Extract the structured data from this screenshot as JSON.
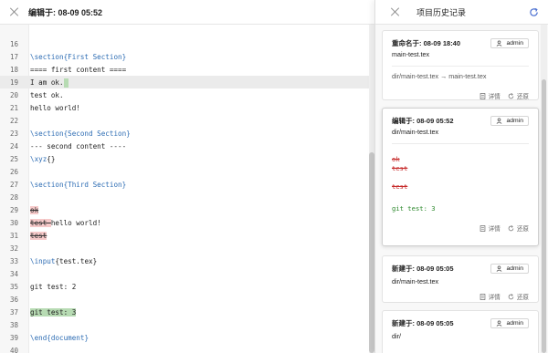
{
  "editor": {
    "title": "编辑于: 08-09 05:52",
    "lines": [
      {
        "num": "16",
        "segments": []
      },
      {
        "num": "17",
        "segments": [
          {
            "t": "\\section",
            "c": "kw"
          },
          {
            "t": "{First Section}",
            "c": "bl"
          }
        ]
      },
      {
        "num": "18",
        "segments": [
          {
            "t": "==== first content ====",
            "c": ""
          }
        ]
      },
      {
        "num": "19",
        "segments": [
          {
            "t": "I am ok.",
            "c": ""
          }
        ],
        "current": true,
        "cursor": true
      },
      {
        "num": "20",
        "segments": [
          {
            "t": "test ok.",
            "c": ""
          }
        ]
      },
      {
        "num": "21",
        "segments": [
          {
            "t": "hello world!",
            "c": ""
          }
        ]
      },
      {
        "num": "22",
        "segments": []
      },
      {
        "num": "23",
        "segments": [
          {
            "t": "\\section",
            "c": "kw"
          },
          {
            "t": "{Second Section}",
            "c": "bl"
          }
        ]
      },
      {
        "num": "24",
        "segments": [
          {
            "t": "--- second content ----",
            "c": ""
          }
        ]
      },
      {
        "num": "25",
        "segments": [
          {
            "t": "\\xyz",
            "c": "kw"
          },
          {
            "t": "{}",
            "c": ""
          }
        ]
      },
      {
        "num": "26",
        "segments": []
      },
      {
        "num": "27",
        "segments": [
          {
            "t": "\\section",
            "c": "kw"
          },
          {
            "t": "{Third Section}",
            "c": "bl"
          }
        ]
      },
      {
        "num": "28",
        "segments": []
      },
      {
        "num": "29",
        "segments": [
          {
            "t": "ok",
            "c": "del"
          }
        ]
      },
      {
        "num": "30",
        "segments": [
          {
            "t": "test ",
            "c": "del"
          },
          {
            "t": "hello world!",
            "c": ""
          }
        ]
      },
      {
        "num": "31",
        "segments": [
          {
            "t": "test",
            "c": "del"
          }
        ]
      },
      {
        "num": "32",
        "segments": []
      },
      {
        "num": "33",
        "segments": [
          {
            "t": "\\input",
            "c": "kw"
          },
          {
            "t": "{test.tex}",
            "c": ""
          }
        ]
      },
      {
        "num": "34",
        "segments": []
      },
      {
        "num": "35",
        "segments": [
          {
            "t": "git test: 2",
            "c": ""
          }
        ]
      },
      {
        "num": "36",
        "segments": []
      },
      {
        "num": "37",
        "segments": [
          {
            "t": "git test: 3",
            "c": "add"
          }
        ]
      },
      {
        "num": "38",
        "segments": []
      },
      {
        "num": "39",
        "segments": [
          {
            "t": "\\end",
            "c": "kw"
          },
          {
            "t": "{document}",
            "c": "bl"
          }
        ]
      },
      {
        "num": "40",
        "segments": []
      }
    ]
  },
  "history": {
    "title": "项目历史记录",
    "cards": [
      {
        "date": "重命名于: 08-09 18:40",
        "user": "admin",
        "file": "main-test.tex",
        "path": "dir/main-test.tex → main-test.tex",
        "detail": "详情",
        "restore": "还原"
      },
      {
        "date": "编辑于: 08-09 05:52",
        "user": "admin",
        "file": "dir/main-test.tex",
        "diff_deleted": [
          "ok",
          "test ",
          "",
          "test"
        ],
        "diff_added": "git test: 3",
        "detail": "详情",
        "restore": "还原"
      },
      {
        "date": "新建于: 08-09 05:05",
        "user": "admin",
        "file": "dir/main-test.tex",
        "detail": "详情",
        "restore": "还原"
      },
      {
        "date": "新建于: 08-09 05:05",
        "user": "admin",
        "file": "dir/"
      }
    ]
  },
  "colors": {
    "keyword": "#2e6db4",
    "deleted_bg": "#f6c9c9",
    "added_bg": "#b7dbb3",
    "deleted_text": "#c62a2a",
    "added_text": "#2f8a2f"
  }
}
